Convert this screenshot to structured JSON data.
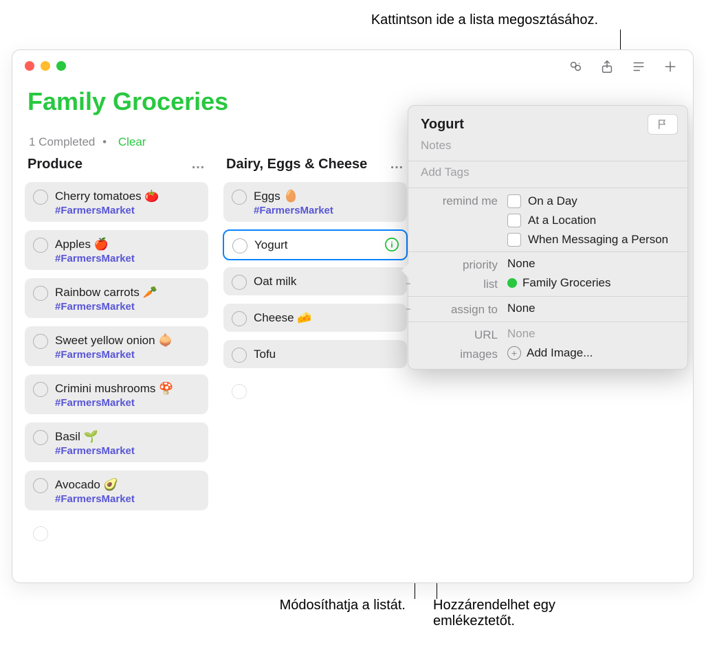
{
  "annotations": {
    "top": "Kattintson ide a lista megosztásához.",
    "bottom_left": "Módosíthatja a listát.",
    "bottom_right": "Hozzárendelhet egy emlékeztetőt."
  },
  "header": {
    "title": "Family Groceries",
    "completed": "1 Completed",
    "clear": "Clear"
  },
  "columns": [
    {
      "title": "Produce",
      "items": [
        {
          "title": "Cherry tomatoes 🍅",
          "tag": "#FarmersMarket"
        },
        {
          "title": "Apples 🍎",
          "tag": "#FarmersMarket"
        },
        {
          "title": "Rainbow carrots 🥕",
          "tag": "#FarmersMarket"
        },
        {
          "title": "Sweet yellow onion 🧅",
          "tag": "#FarmersMarket"
        },
        {
          "title": "Crimini mushrooms 🍄",
          "tag": "#FarmersMarket"
        },
        {
          "title": "Basil 🌱",
          "tag": "#FarmersMarket"
        },
        {
          "title": "Avocado 🥑",
          "tag": "#FarmersMarket"
        }
      ]
    },
    {
      "title": "Dairy, Eggs & Cheese",
      "items": [
        {
          "title": "Eggs 🥚",
          "tag": "#FarmersMarket"
        },
        {
          "title": "Yogurt",
          "selected": true,
          "info": true
        },
        {
          "title": "Oat milk"
        },
        {
          "title": "Cheese 🧀"
        },
        {
          "title": "Tofu"
        }
      ]
    }
  ],
  "detail": {
    "title": "Yogurt",
    "notes_placeholder": "Notes",
    "tags_placeholder": "Add Tags",
    "remind_label": "remind me",
    "remind_options": [
      "On a Day",
      "At a Location",
      "When Messaging a Person"
    ],
    "priority_label": "priority",
    "priority_value": "None",
    "list_label": "list",
    "list_value": "Family Groceries",
    "assign_label": "assign to",
    "assign_value": "None",
    "url_label": "URL",
    "url_value": "None",
    "images_label": "images",
    "images_value": "Add Image..."
  }
}
